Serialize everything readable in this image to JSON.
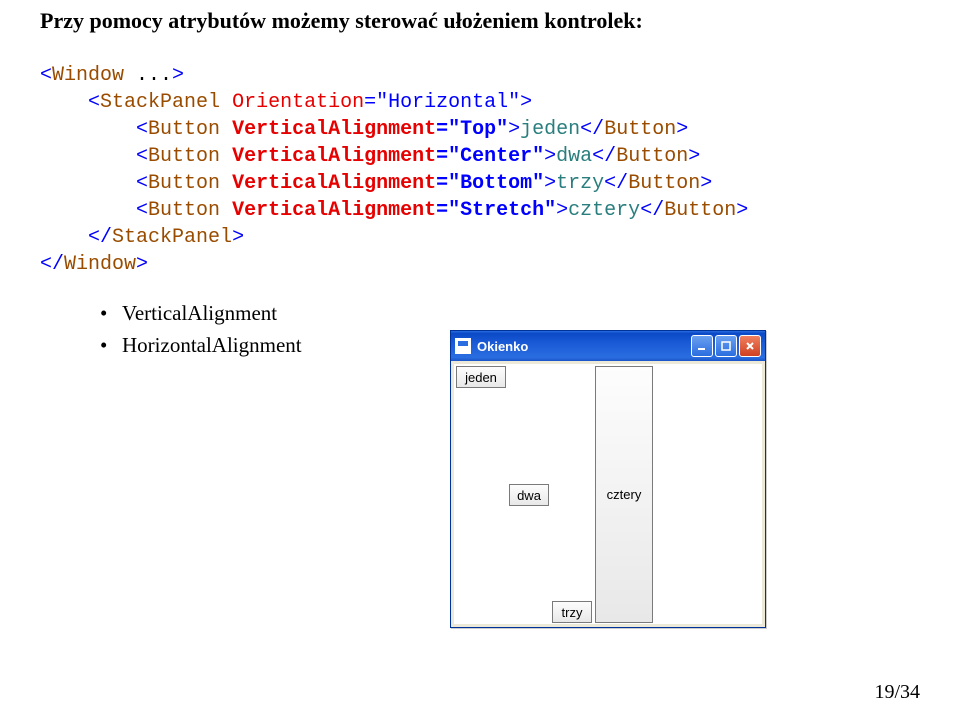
{
  "heading": "Przy pomocy atrybutów możemy sterować ułożeniem kontrolek:",
  "code": {
    "l1": {
      "a": "<",
      "tag": "Window",
      "b": " ...",
      "c": ">"
    },
    "l2": {
      "indent": "    ",
      "a": "<",
      "tag": "StackPanel",
      "sp": " ",
      "attr": "Orientation",
      "eq": "=",
      "val": "\"Horizontal\"",
      "c": ">"
    },
    "l3": {
      "indent": "        ",
      "a": "<",
      "tag": "Button",
      "sp": " ",
      "attr": "VerticalAlignment",
      "eq": "=",
      "val": "\"Top\"",
      "c": ">",
      "text": "jeden",
      "d": "</",
      "tag2": "Button",
      "e": ">"
    },
    "l4": {
      "indent": "        ",
      "a": "<",
      "tag": "Button",
      "sp": " ",
      "attr": "VerticalAlignment",
      "eq": "=",
      "val": "\"Center\"",
      "c": ">",
      "text": "dwa",
      "d": "</",
      "tag2": "Button",
      "e": ">"
    },
    "l5": {
      "indent": "        ",
      "a": "<",
      "tag": "Button",
      "sp": " ",
      "attr": "VerticalAlignment",
      "eq": "=",
      "val": "\"Bottom\"",
      "c": ">",
      "text": "trzy",
      "d": "</",
      "tag2": "Button",
      "e": ">"
    },
    "l6": {
      "indent": "        ",
      "a": "<",
      "tag": "Button",
      "sp": " ",
      "attr": "VerticalAlignment",
      "eq": "=",
      "val": "\"Stretch\"",
      "c": ">",
      "text": "cztery",
      "d": "</",
      "tag2": "Button",
      "e": ">"
    },
    "l7": {
      "indent": "    ",
      "a": "</",
      "tag": "StackPanel",
      "c": ">"
    },
    "l8": {
      "a": "</",
      "tag": "Window",
      "c": ">"
    }
  },
  "bullets": [
    "VerticalAlignment",
    "HorizontalAlignment"
  ],
  "window": {
    "title": "Okienko",
    "buttons": {
      "jeden": "jeden",
      "dwa": "dwa",
      "trzy": "trzy",
      "cztery": "cztery"
    }
  },
  "pageNum": "19/34"
}
